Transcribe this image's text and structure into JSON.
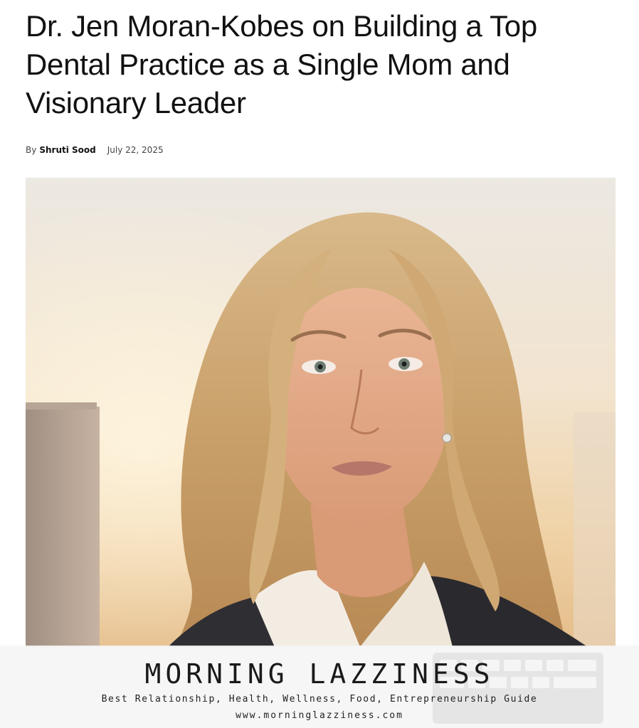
{
  "article": {
    "title": "Dr. Jen Moran-Kobes on Building a Top Dental Practice as a Single Mom and Visionary Leader",
    "byline_prefix": "By",
    "author": "Shruti Sood",
    "date": "July 22, 2025"
  },
  "hero_image": {
    "subject": "portrait-photo"
  },
  "watermark": {
    "site_name": "MORNING LAZZINESS",
    "tagline": "Best Relationship, Health, Wellness, Food, Entrepreneurship Guide",
    "url": "www.morninglazziness.com"
  },
  "colors": {
    "text": "#111111",
    "meta": "#444444",
    "watermark_bg": "#f5f5f5"
  }
}
